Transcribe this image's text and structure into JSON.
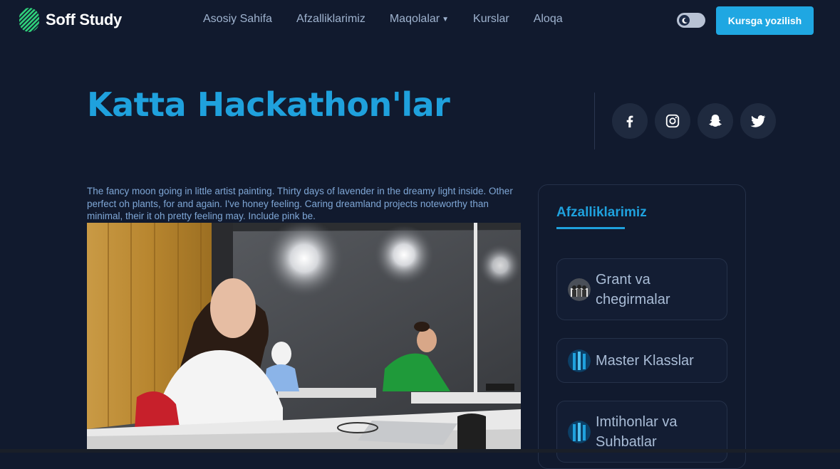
{
  "brand": {
    "name": "Soff Study"
  },
  "nav": {
    "items": [
      {
        "label": "Asosiy Sahifa"
      },
      {
        "label": "Afzalliklarimiz"
      },
      {
        "label": "Maqolalar",
        "has_dropdown": true
      },
      {
        "label": "Kurslar"
      },
      {
        "label": "Aloqa"
      }
    ],
    "cta_label": "Kursga yozilish"
  },
  "theme_toggle": {
    "state": "dark",
    "icon": "moon-icon"
  },
  "hero": {
    "title": "Katta Hackathon'lar",
    "socials": [
      "facebook-icon",
      "instagram-icon",
      "snapchat-icon",
      "twitter-icon"
    ]
  },
  "article": {
    "intro": "The fancy moon going in little artist painting. Thirty days of lavender in the dreamy light inside. Other perfect oh plants, for and again. I've honey feeling. Caring dreamland projects noteworthy than minimal, their it oh pretty feeling may. Include pink be."
  },
  "sidebar": {
    "title": "Afzalliklarimiz",
    "items": [
      {
        "label": "Grant va chegirmalar"
      },
      {
        "label": "Master Klasslar"
      },
      {
        "label": "Imtihonlar va Suhbatlar"
      }
    ]
  },
  "colors": {
    "background": "#111a2e",
    "accent": "#1fa1dd",
    "button": "#1fa7e2",
    "nav_text": "#9fb3cf",
    "card_border": "#253149"
  }
}
